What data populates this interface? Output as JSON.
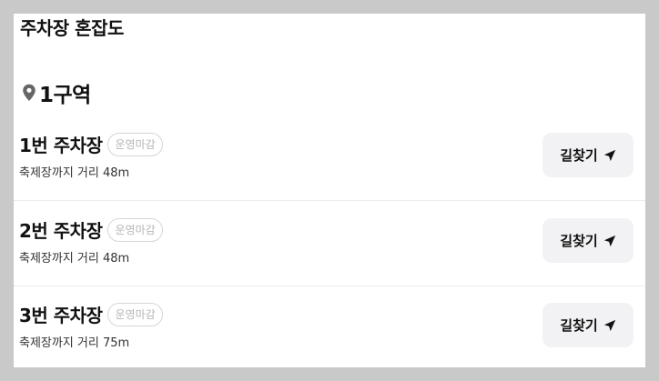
{
  "header": {
    "title": "주차장 혼잡도"
  },
  "zone": {
    "label": "1구역",
    "icon": "location-pin-icon"
  },
  "lots": [
    {
      "name": "1번 주차장",
      "status": "운영마감",
      "distance": "축제장까지 거리 48m",
      "route_label": "길찾기"
    },
    {
      "name": "2번 주차장",
      "status": "운영마감",
      "distance": "축제장까지 거리 48m",
      "route_label": "길찾기"
    },
    {
      "name": "3번 주차장",
      "status": "운영마감",
      "distance": "축제장까지 거리 75m",
      "route_label": "길찾기"
    }
  ],
  "icons": {
    "route": "navigation-arrow-icon"
  }
}
